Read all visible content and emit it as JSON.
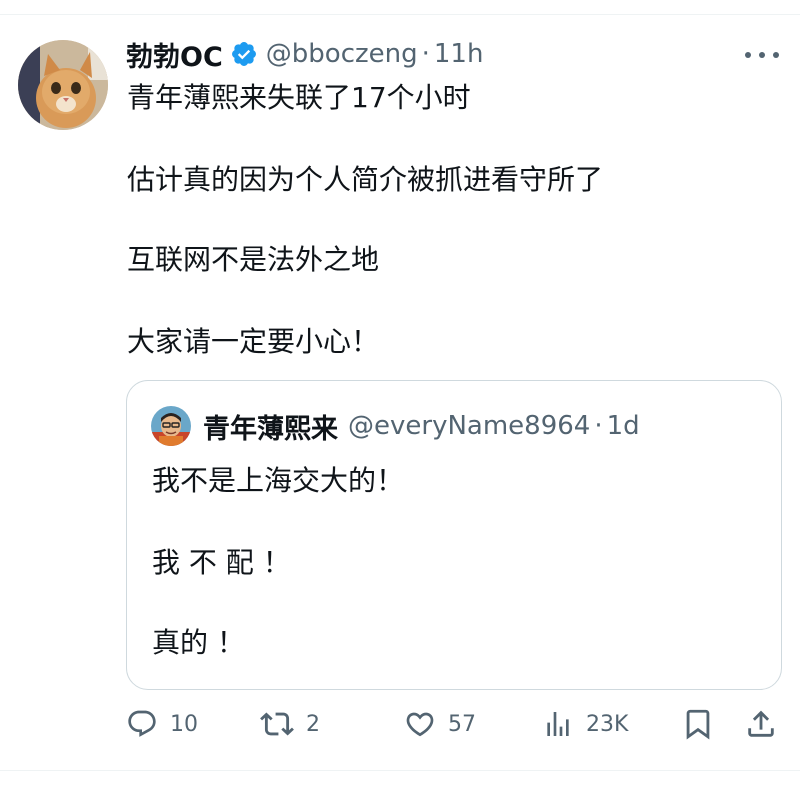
{
  "post": {
    "author_name": "勃勃OC",
    "handle": "@bboczeng",
    "separator": "·",
    "time": "11h",
    "lines": [
      "青年薄熙来失联了17个小时",
      "估计真的因为个人简介被抓进看守所了",
      "互联网不是法外之地",
      "大家请一定要小心！"
    ],
    "verified": true,
    "accent_color": "#1d9bf0"
  },
  "quoted": {
    "author_name": "青年薄熙来",
    "handle": "@everyName8964",
    "separator": "·",
    "time": "1d",
    "lines": [
      "我不是上海交大的！",
      "我 不 配 ！",
      "真的 ！"
    ]
  },
  "actions": {
    "replies": "10",
    "reposts": "2",
    "likes": "57",
    "views": "23K",
    "icons": [
      "reply-icon",
      "repost-icon",
      "like-icon",
      "views-icon",
      "bookmark-icon",
      "share-icon"
    ]
  }
}
